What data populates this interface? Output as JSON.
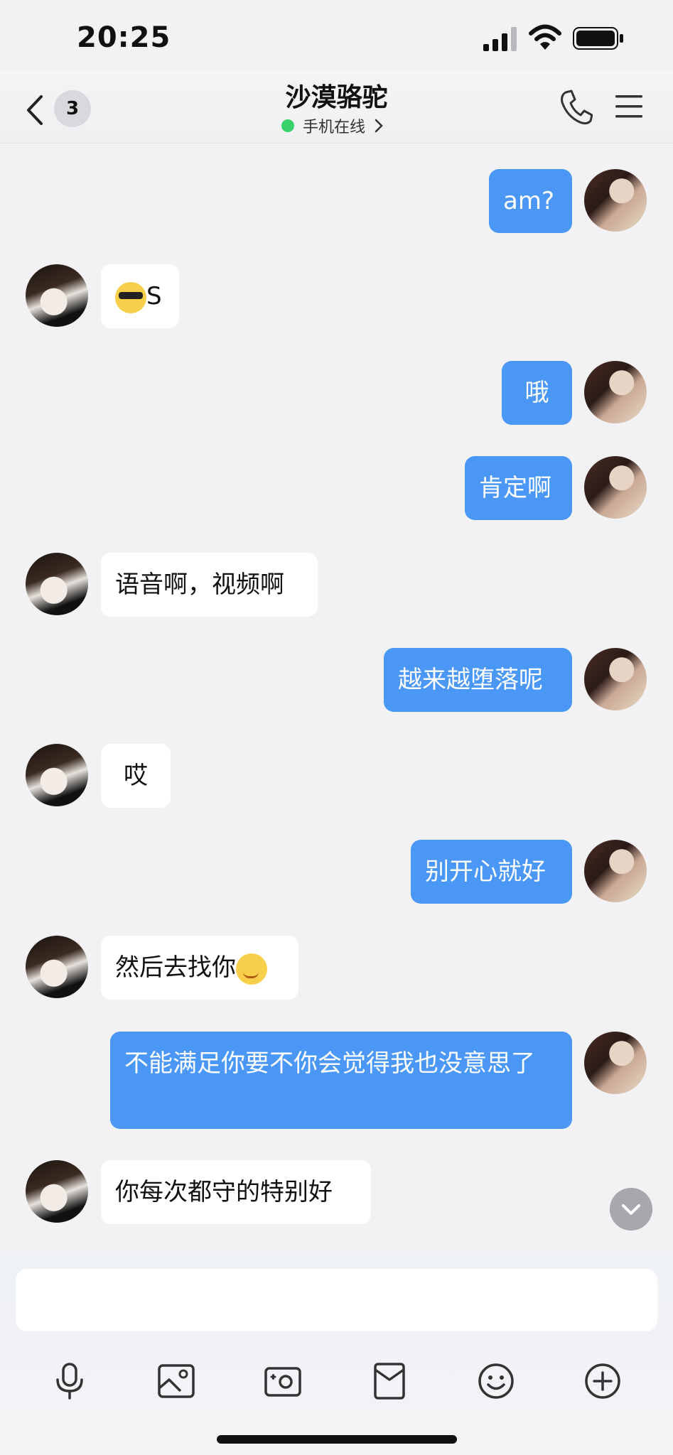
{
  "status_bar": {
    "time": "20:25"
  },
  "header": {
    "unread_count": "3",
    "contact_name": "沙漠骆驼",
    "online_status": "手机在线"
  },
  "messages": [
    {
      "side": "out",
      "text": "am?"
    },
    {
      "side": "in",
      "text": "S",
      "emoji": "sunglasses-emoji"
    },
    {
      "side": "out",
      "text": "哦"
    },
    {
      "side": "out",
      "text": "肯定啊"
    },
    {
      "side": "in",
      "text": "语音啊，视频啊"
    },
    {
      "side": "out",
      "text": "越来越堕落呢"
    },
    {
      "side": "in",
      "text": "哎"
    },
    {
      "side": "out",
      "text": "别开心就好"
    },
    {
      "side": "in",
      "text": "然后去找你",
      "emoji": "sly-smile-emoji"
    },
    {
      "side": "out",
      "text": "不能满足你要不你会觉得我也没意思了"
    },
    {
      "side": "in",
      "text": "你每次都守的特别好"
    }
  ],
  "input": {
    "placeholder": ""
  },
  "toolbar_icons": [
    "microphone-icon",
    "image-icon",
    "camera-icon",
    "red-packet-icon",
    "emoji-icon",
    "plus-icon"
  ],
  "colors": {
    "outgoing_bubble": "#4a97f5",
    "incoming_bubble": "#ffffff",
    "background": "#f2f2f4",
    "online_dot": "#38d16a"
  }
}
